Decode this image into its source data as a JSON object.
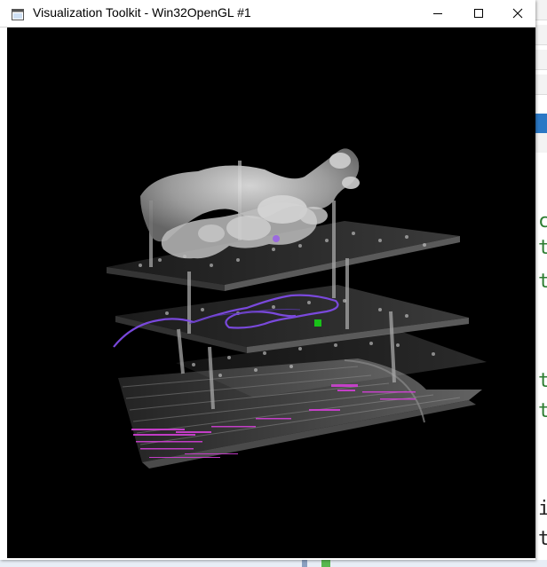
{
  "window": {
    "title": "Visualization Toolkit - Win32OpenGL #1",
    "controls": [
      "minimize",
      "maximize",
      "close"
    ]
  },
  "viewport": {
    "background": "#000000",
    "scene": "3d-volume-render"
  },
  "colors": {
    "slab": "#7d7d7d",
    "skull": "#cfcfcf",
    "purple_path": "#7e4be6",
    "magenta": "#d23fd6",
    "green_marker": "#19c219"
  },
  "background_app": {
    "code_chars": [
      "c",
      "t",
      "t",
      "t",
      "t",
      "i",
      "t"
    ]
  }
}
